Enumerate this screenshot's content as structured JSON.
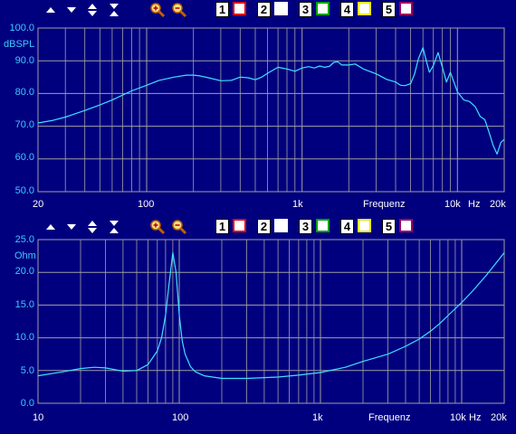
{
  "colors": {
    "background": "#00007f",
    "grid": "#a0a0a0",
    "curve": "#40e0ff",
    "axis_label": "#40c8ff",
    "tick_label": "#ffffff"
  },
  "toolbar_icons": [
    "arrow-up-icon",
    "arrow-down-icon",
    "expand-vertical-icon",
    "compress-vertical-icon",
    "zoom-in-icon",
    "zoom-out-icon"
  ],
  "channels": [
    {
      "label": "1",
      "color": "#e00000"
    },
    {
      "label": "2",
      "color": "#ffffff"
    },
    {
      "label": "3",
      "color": "#00a000"
    },
    {
      "label": "4",
      "color": "#e8e800"
    },
    {
      "label": "5",
      "color": "#a00060"
    }
  ],
  "chart_data": [
    {
      "type": "line",
      "ylabel": "dBSPL",
      "xlabel": "Frequenz",
      "x_scale": "log",
      "xlim": [
        20,
        20000
      ],
      "ylim": [
        50,
        100
      ],
      "y_ticks": [
        "100.0",
        "90.0",
        "80.0",
        "70.0",
        "60.0",
        "50.0"
      ],
      "x_tick_labels": [
        "20",
        "100",
        "1k",
        "10k",
        "Hz",
        "20k"
      ],
      "series": [
        {
          "x": [
            20,
            25,
            30,
            40,
            50,
            60,
            70,
            80,
            100,
            120,
            150,
            180,
            200,
            220,
            250,
            300,
            350,
            400,
            450,
            500,
            550,
            600,
            700,
            800,
            900,
            1000,
            1100,
            1200,
            1300,
            1400,
            1500,
            1600,
            1700,
            1800,
            2000,
            2200,
            2500,
            3000,
            3500,
            4000,
            4300,
            4600,
            4800,
            5000,
            5300,
            5600,
            6000,
            6300,
            6600,
            7000,
            7500,
            8000,
            8500,
            9000,
            10000,
            11000,
            12000,
            13000,
            14000,
            15000,
            16000,
            17000,
            18000,
            19000,
            20000
          ],
          "y": [
            71,
            71.8,
            72.8,
            74.8,
            76.5,
            78,
            79.5,
            80.8,
            82.5,
            84,
            85,
            85.6,
            85.6,
            85.4,
            84.8,
            83.9,
            84,
            85,
            84.8,
            84.2,
            85,
            86.2,
            88,
            87.5,
            86.8,
            87.8,
            88.2,
            87.8,
            88.4,
            88,
            88.3,
            89.5,
            89.7,
            88.7,
            88.7,
            89,
            87.4,
            86,
            84.3,
            83.5,
            82.5,
            82.4,
            82.7,
            83,
            86,
            90.5,
            94,
            90,
            86.5,
            88.5,
            92.5,
            88,
            83.5,
            86.5,
            80.5,
            78,
            77.5,
            76,
            73,
            72,
            68,
            64,
            61.5,
            65,
            66
          ]
        }
      ]
    },
    {
      "type": "line",
      "ylabel": "Ohm",
      "xlabel": "Frequenz",
      "x_scale": "log",
      "xlim": [
        10,
        20000
      ],
      "ylim": [
        0,
        25
      ],
      "y_ticks": [
        "25.0",
        "20.0",
        "15.0",
        "10.0",
        "5.0",
        "0.0"
      ],
      "x_tick_labels": [
        "10",
        "100",
        "1k",
        "10k",
        "Hz",
        "20k"
      ],
      "series": [
        {
          "x": [
            10,
            15,
            20,
            25,
            30,
            40,
            50,
            60,
            70,
            75,
            80,
            85,
            90,
            95,
            100,
            105,
            110,
            120,
            130,
            150,
            200,
            300,
            500,
            700,
            1000,
            1500,
            2000,
            3000,
            4000,
            5000,
            6000,
            7000,
            8000,
            10000,
            12000,
            15000,
            20000
          ],
          "y": [
            4.2,
            4.8,
            5.3,
            5.5,
            5.4,
            4.9,
            5,
            5.9,
            8,
            10,
            13.5,
            18.5,
            23,
            20,
            13.5,
            9.5,
            7.5,
            5.6,
            4.8,
            4.2,
            3.8,
            3.8,
            4,
            4.3,
            4.7,
            5.5,
            6.4,
            7.5,
            8.7,
            9.8,
            11,
            12.2,
            13.4,
            15.4,
            17.2,
            19.6,
            23
          ]
        }
      ]
    }
  ]
}
